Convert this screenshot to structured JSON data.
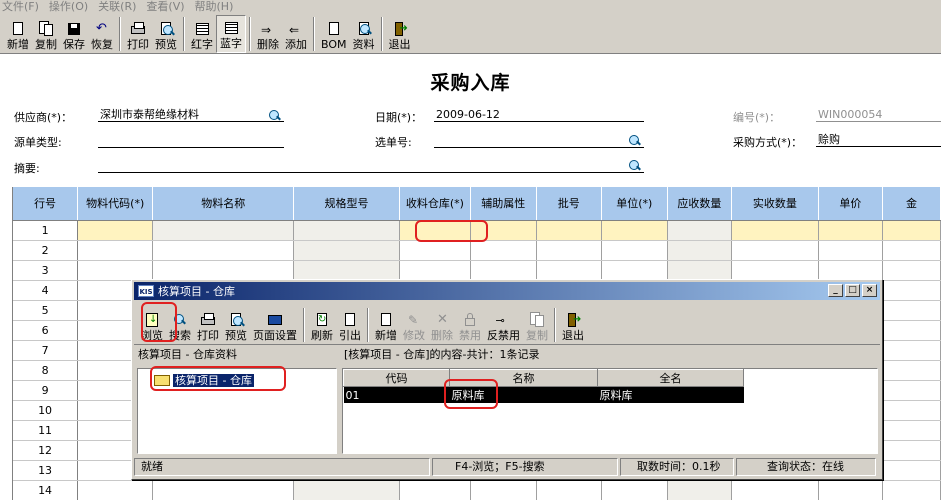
{
  "menu": [
    "文件(F)",
    "操作(O)",
    "关联(R)",
    "查看(V)",
    "帮助(H)"
  ],
  "toolbar": {
    "new": "新增",
    "copy": "复制",
    "save": "保存",
    "restore": "恢复",
    "print": "打印",
    "preview": "预览",
    "red": "红字",
    "blue": "蓝字",
    "delete": "删除",
    "add": "添加",
    "bom": "BOM",
    "info": "资料",
    "exit": "退出"
  },
  "form": {
    "title": "采购入库",
    "supplier_label": "供应商(*)：",
    "supplier_value": "深圳市泰帮绝缘材料",
    "date_label": "日期(*)：",
    "date_value": "2009-06-12",
    "number_label": "编号(*)：",
    "number_value": "WIN000054",
    "source_label": "源单类型:",
    "select_label": "选单号:",
    "method_label": "采购方式(*)：",
    "method_value": "赊购",
    "summary_label": "摘要:"
  },
  "grid": {
    "columns": [
      "行号",
      "物料代码(*)",
      "物料名称",
      "规格型号",
      "收料仓库(*)",
      "辅助属性",
      "批号",
      "单位(*)",
      "应收数量",
      "实收数量",
      "单价",
      "金"
    ],
    "rows": [
      "1",
      "2",
      "3",
      "4",
      "5",
      "6",
      "7",
      "8",
      "9",
      "10",
      "11",
      "12",
      "13",
      "14"
    ]
  },
  "dialog": {
    "title": "核算项目 - 仓库",
    "kis": "KIS",
    "toolbar": {
      "browse": "浏览",
      "search": "搜索",
      "print": "打印",
      "preview": "预览",
      "page_setup": "页面设置",
      "refresh": "刷新",
      "import": "引出",
      "add": "新增",
      "modify": "修改",
      "delete": "删除",
      "disable": "禁用",
      "enable": "反禁用",
      "copy": "复制",
      "exit": "退出"
    },
    "left_header": "核算项目 - 仓库资料",
    "tree_node": "核算项目 - 仓库",
    "right_header": "[核算项目 - 仓库]的内容-共计：1条记录",
    "list_columns": [
      "代码",
      "名称",
      "全名"
    ],
    "list_rows": [
      [
        "01",
        "原料库",
        "原料库"
      ]
    ],
    "status": {
      "ready": "就绪",
      "keys": "F4-浏览；F5-搜索",
      "time": "取数时间：0.1秒",
      "query": "查询状态：在线"
    }
  },
  "highlight_color": "#e02020",
  "selection_color": "#0a246a",
  "header_color": "#a8c8ec"
}
